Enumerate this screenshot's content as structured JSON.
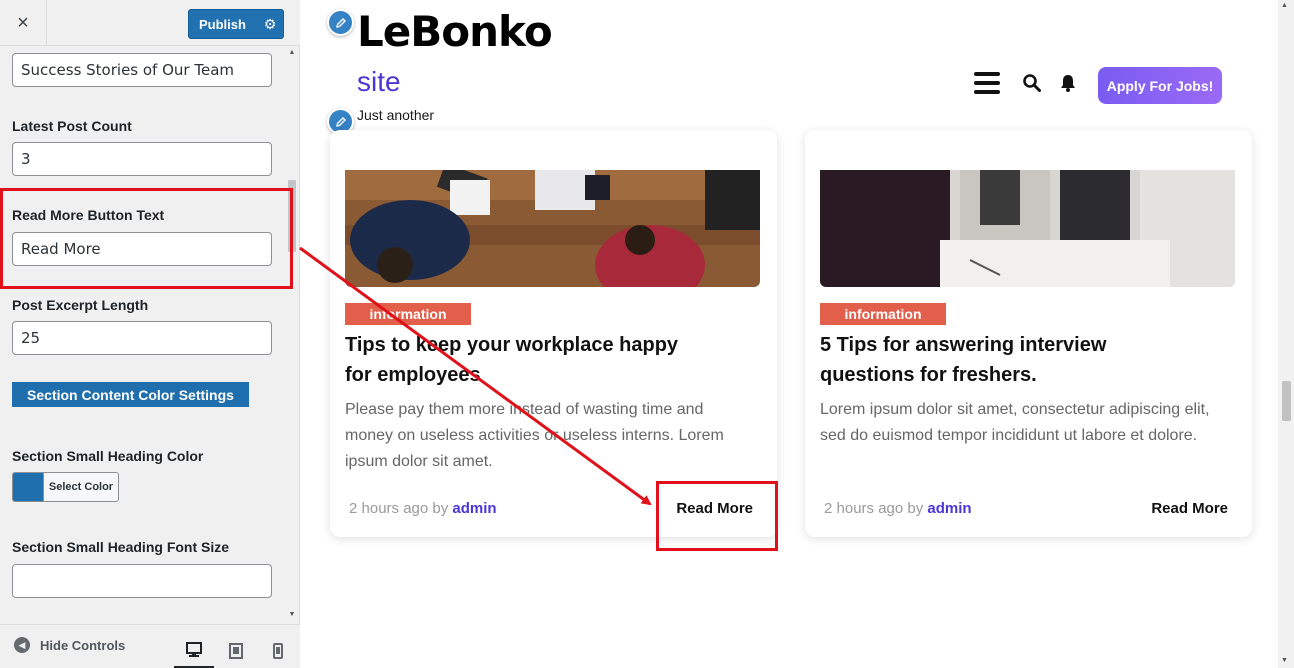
{
  "sidebar": {
    "close_icon": "×",
    "publish_label": "Publish",
    "fields": {
      "section_heading_value": "Success Stories of Our Team",
      "latest_post_count_label": "Latest Post Count",
      "latest_post_count_value": "3",
      "read_more_label": "Read More Button Text",
      "read_more_value": "Read More",
      "excerpt_length_label": "Post Excerpt Length",
      "excerpt_length_value": "25",
      "content_color_settings_label": "Section Content Color Settings",
      "small_heading_color_label": "Section Small Heading Color",
      "select_color_label": "Select Color",
      "small_heading_font_size_label": "Section Small Heading Font Size",
      "small_heading_font_size_value": ""
    },
    "footer": {
      "hide_controls_label": "Hide Controls",
      "device_icons": [
        "desktop-icon",
        "tablet-icon",
        "mobile-icon"
      ]
    }
  },
  "preview": {
    "site_title": "LeBonko",
    "site_title_line2": "site",
    "tagline": "Just another WordPress site",
    "apply_button": "Apply For Jobs!",
    "posts": [
      {
        "category": "information",
        "title": "Tips to keep your workplace happy for employees",
        "excerpt": "Please pay them more instead of wasting time and money on useless activities or useless interns. Lorem ipsum dolor sit amet.",
        "meta_time": "2 hours ago by ",
        "author": "admin",
        "read_more": "Read More"
      },
      {
        "category": "information",
        "title": "5 Tips for answering interview questions for freshers.",
        "excerpt": "Lorem ipsum dolor sit amet, consectetur adipiscing elit, sed do euismod tempor incididunt ut labore et dolore.",
        "meta_time": "2 hours ago by ",
        "author": "admin",
        "read_more": "Read More"
      }
    ]
  },
  "colors": {
    "accent": "#2271b1",
    "brand_purple": "#7a5cf2",
    "category_badge": "#e2604b",
    "annotation_red": "#e0111a"
  }
}
